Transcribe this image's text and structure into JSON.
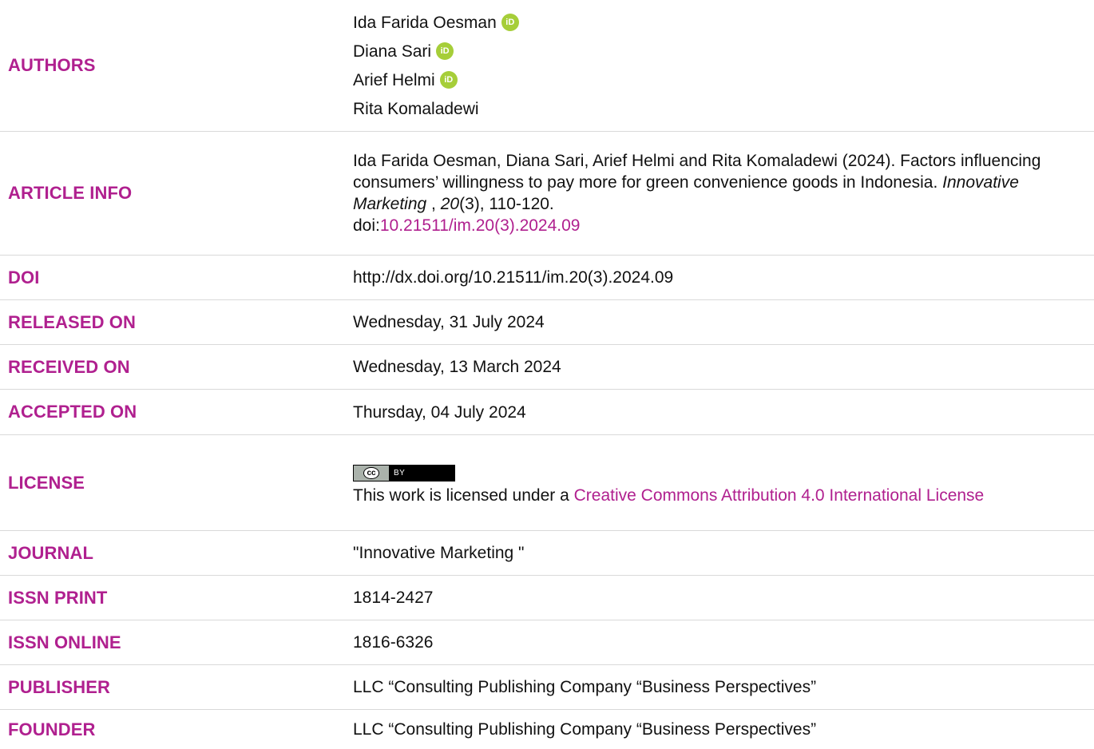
{
  "authors": {
    "label": "AUTHORS",
    "list": [
      {
        "name": "Ida Farida Oesman",
        "orcid": true
      },
      {
        "name": "Diana Sari",
        "orcid": true
      },
      {
        "name": "Arief Helmi",
        "orcid": true
      },
      {
        "name": "Rita Komaladewi",
        "orcid": false
      }
    ],
    "orcid_glyph": "iD"
  },
  "article_info": {
    "label": "ARTICLE INFO",
    "citation_prefix": "Ida Farida Oesman, Diana Sari, Arief Helmi and Rita Komaladewi (2024). Factors influencing consumers’ willingness to pay more for green convenience goods in Indonesia. ",
    "journal_italic": "Innovative Marketing",
    "sep": " , ",
    "volume_italic": "20",
    "issue_pages": "(3), 110-120.",
    "doi_prefix": "doi:",
    "doi_link": "10.21511/im.20(3).2024.09"
  },
  "doi": {
    "label": "DOI",
    "value": "http://dx.doi.org/10.21511/im.20(3).2024.09"
  },
  "released": {
    "label": "RELEASED ON",
    "value": "Wednesday, 31 July 2024"
  },
  "received": {
    "label": "RECEIVED ON",
    "value": "Wednesday, 13 March 2024"
  },
  "accepted": {
    "label": "ACCEPTED ON",
    "value": "Thursday, 04 July 2024"
  },
  "license": {
    "label": "LICENSE",
    "badge_left": "cc",
    "badge_right": "BY",
    "text_prefix": "This work is licensed under a ",
    "link_text": "Creative Commons Attribution 4.0 International License"
  },
  "journal": {
    "label": "JOURNAL",
    "value": "\"Innovative Marketing \""
  },
  "issn_print": {
    "label": "ISSN PRINT",
    "value": "1814-2427"
  },
  "issn_online": {
    "label": "ISSN ONLINE",
    "value": "1816-6326"
  },
  "publisher": {
    "label": "PUBLISHER",
    "value": "LLC “Consulting Publishing Company “Business Perspectives”"
  },
  "founder": {
    "label": "FOUNDER",
    "value": "LLC “Consulting Publishing Company “Business Perspectives”"
  },
  "colors": {
    "accent": "#b0208f",
    "orcid": "#a6ce39",
    "divider": "#d9d9d9"
  }
}
